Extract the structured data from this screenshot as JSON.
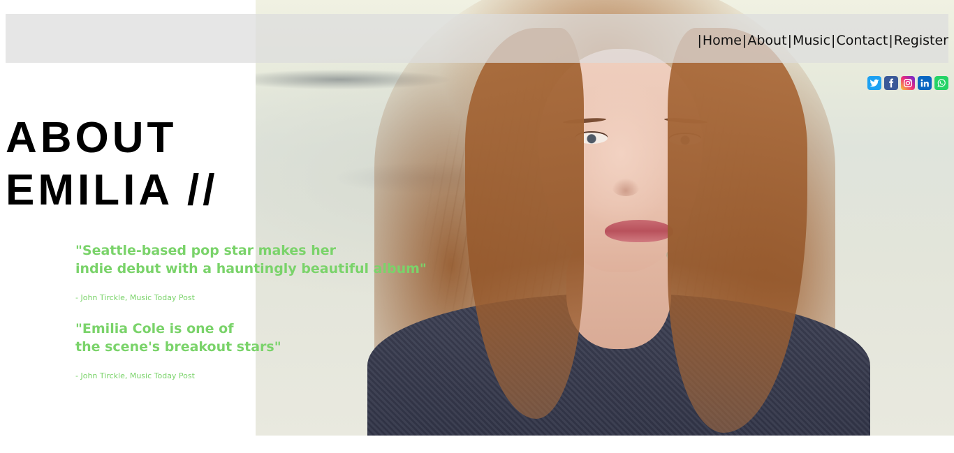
{
  "nav": {
    "separator": "|",
    "links": [
      "Home",
      "About",
      "Music",
      "Contact",
      "Register"
    ]
  },
  "social": {
    "icons": [
      "twitter-icon",
      "facebook-icon",
      "instagram-icon",
      "linkedin-icon",
      "whatsapp-icon"
    ]
  },
  "heading": {
    "line1": "ABOUT",
    "line2": "EMILIA //"
  },
  "quotes": [
    {
      "line1": "\"Seattle-based pop star makes her",
      "line2": "indie debut with a hauntingly beautiful album\"",
      "attribution": "- John Tirckle, Music Today Post"
    },
    {
      "line1": "\"Emilia Cole is one of",
      "line2": "the scene's breakout stars\"",
      "attribution": "- John Tirckle, Music Today Post"
    }
  ],
  "colors": {
    "quote_green": "#7ad36a",
    "nav_bar": "#dcdcdc",
    "heading": "#000000"
  }
}
